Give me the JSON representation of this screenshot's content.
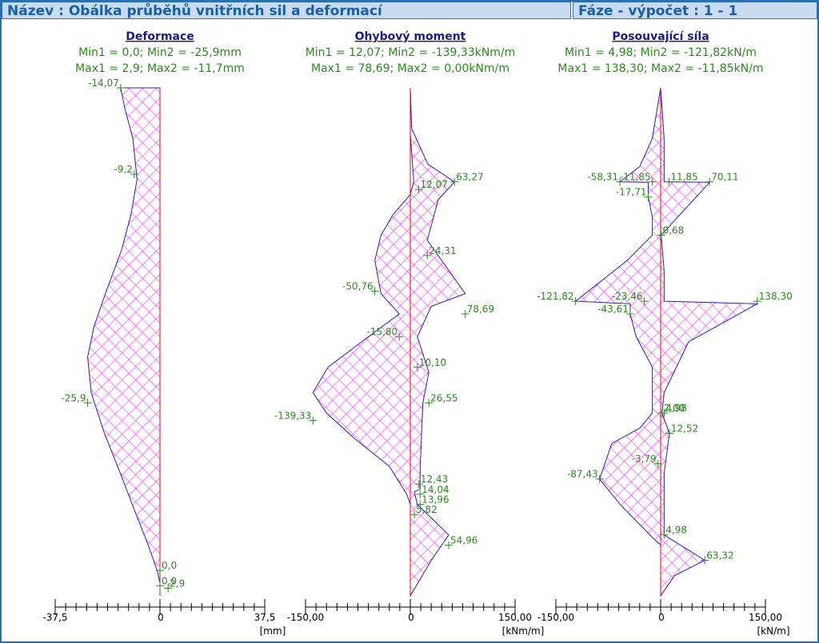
{
  "header": {
    "title": "Název : Obálka průběhů vnitřních sil a deformací",
    "phase": "Fáze - výpočet : 1 - 1"
  },
  "colors": {
    "fill": "#ff44ff",
    "outline": "#2020c0",
    "axis": "#ff0000",
    "label": "#2b8a1e",
    "title": "#1a1a8c",
    "header_bg": "#c9dcef",
    "header_text": "#1a5fa6"
  },
  "chart_data": [
    {
      "type": "area",
      "title": "Deformace",
      "stats": [
        "Min1 = 0,0; Min2 = -25,9mm",
        "Max1 = 2,9; Max2 = -11,7mm"
      ],
      "unit": "[mm]",
      "xlim": [
        -37.5,
        37.5
      ],
      "tick_labels": {
        "min": "-37,5",
        "zero": "0",
        "max": "37,5"
      },
      "depth_range": [
        0,
        1
      ],
      "envelope_min": {
        "depth": [
          0,
          0.04,
          0.1,
          0.18,
          0.25,
          0.32,
          0.4,
          0.47,
          0.53,
          0.6,
          0.68,
          0.76,
          0.84,
          0.9,
          0.95,
          0.975,
          1
        ],
        "value": [
          -14.07,
          -12.6,
          -9.7,
          -8.2,
          -10.4,
          -13.8,
          -19.2,
          -23.6,
          -25.9,
          -24.6,
          -19.9,
          -14.1,
          -8.5,
          -4.2,
          -1.0,
          0.0,
          0.0
        ]
      },
      "envelope_max": {
        "depth": [
          0,
          1
        ],
        "value": [
          0,
          0
        ]
      },
      "labels": [
        {
          "text": "-14,07",
          "value": -14.07,
          "depth": 0.0
        },
        {
          "text": "-9,2",
          "value": -9.2,
          "depth": 0.17
        },
        {
          "text": "-25,9",
          "value": -25.9,
          "depth": 0.62
        },
        {
          "text": "0,0",
          "value": 0.0,
          "depth": 0.95
        },
        {
          "text": "0,0",
          "value": 0.0,
          "depth": 0.98
        },
        {
          "text": "2,9",
          "value": 2.9,
          "depth": 0.985
        }
      ]
    },
    {
      "type": "area",
      "title": "Ohybový moment",
      "stats": [
        "Min1 = 12,07; Min2 = -139,33kNm/m",
        "Max1 = 78,69; Max2 = 0,00kNm/m"
      ],
      "unit": "[kNm/m]",
      "xlim": [
        -150,
        150
      ],
      "tick_labels": {
        "min": "-150,00",
        "zero": "0",
        "max": "150,00"
      },
      "depth_range": [
        0,
        1
      ],
      "envelope_min": {
        "depth": [
          0,
          0.09,
          0.185,
          0.21,
          0.25,
          0.29,
          0.34,
          0.405,
          0.445,
          0.49,
          0.55,
          0.6,
          0.64,
          0.69,
          0.745,
          0.8,
          0.82,
          1
        ],
        "value": [
          0,
          0,
          5,
          0,
          -25,
          -42,
          -50.76,
          -42,
          -15.8,
          -60,
          -118,
          -139.33,
          -120,
          -80,
          -30,
          -5,
          0,
          0
        ]
      },
      "envelope_max": {
        "depth": [
          0,
          0.08,
          0.15,
          0.185,
          0.22,
          0.3,
          0.405,
          0.43,
          0.49,
          0.56,
          0.62,
          0.75,
          0.79,
          0.795,
          0.82,
          0.88,
          0.93,
          1
        ],
        "value": [
          0,
          2,
          25,
          63.27,
          40,
          24.31,
          78.69,
          30,
          10.1,
          26.55,
          18,
          14.04,
          13.96,
          5.82,
          10,
          54.96,
          30,
          0
        ]
      },
      "labels": [
        {
          "text": "63,27",
          "value": 63.27,
          "depth": 0.185
        },
        {
          "text": "12,07",
          "value": 12.07,
          "depth": 0.2
        },
        {
          "text": "24,31",
          "value": 24.31,
          "depth": 0.33
        },
        {
          "text": "-50,76",
          "value": -50.76,
          "depth": 0.4
        },
        {
          "text": "78,69",
          "value": 78.69,
          "depth": 0.445
        },
        {
          "text": "-15,80",
          "value": -15.8,
          "depth": 0.49
        },
        {
          "text": "10,10",
          "value": 10.1,
          "depth": 0.55
        },
        {
          "text": "26,55",
          "value": 26.55,
          "depth": 0.62
        },
        {
          "text": "-139,33",
          "value": -139.33,
          "depth": 0.655
        },
        {
          "text": "12,43",
          "value": 12.43,
          "depth": 0.78
        },
        {
          "text": "14,04",
          "value": 14.04,
          "depth": 0.8
        },
        {
          "text": "13,96",
          "value": 13.96,
          "depth": 0.82
        },
        {
          "text": "5,82",
          "value": 5.82,
          "depth": 0.84
        },
        {
          "text": "54,96",
          "value": 54.96,
          "depth": 0.9
        }
      ]
    },
    {
      "type": "area",
      "title": "Posouvající síla",
      "stats": [
        "Min1 = 4,98; Min2 = -121,82kN/m",
        "Max1 = 138,30; Max2 = -11,85kN/m"
      ],
      "unit": "[kN/m]",
      "xlim": [
        -150,
        150
      ],
      "tick_labels": {
        "min": "-150,00",
        "zero": "0",
        "max": "150,00"
      },
      "depth_range": [
        0,
        1
      ],
      "envelope_min": {
        "depth": [
          0,
          0.1,
          0.155,
          0.185,
          0.186,
          0.215,
          0.255,
          0.29,
          0.34,
          0.42,
          0.425,
          0.445,
          0.49,
          0.55,
          0.64,
          0.67,
          0.7,
          0.77,
          0.82,
          0.885,
          0.9,
          1
        ],
        "value": [
          0,
          -12,
          -30,
          -58.31,
          -17.71,
          -17.71,
          -11.85,
          -11.85,
          -48,
          -121.82,
          -43.61,
          -43.61,
          -35,
          -11.85,
          -11.85,
          -30,
          -70,
          -87.43,
          -58,
          -11.85,
          0,
          0
        ]
      },
      "envelope_max": {
        "depth": [
          0,
          0.1,
          0.185,
          0.186,
          0.29,
          0.36,
          0.42,
          0.425,
          0.5,
          0.6,
          0.64,
          0.68,
          0.76,
          0.88,
          0.93,
          0.96,
          1
        ],
        "value": [
          0,
          4.98,
          4.98,
          70.11,
          0.68,
          4.98,
          4.98,
          138.3,
          40,
          4.98,
          2.0,
          12.52,
          4.98,
          4.98,
          63.32,
          20,
          0
        ]
      },
      "labels": [
        {
          "text": "-58,31",
          "value": -58.31,
          "depth": 0.185
        },
        {
          "text": "-11,85",
          "value": -11.85,
          "depth": 0.185
        },
        {
          "text": "11,85",
          "value": 11.85,
          "depth": 0.185
        },
        {
          "text": "70,11",
          "value": 70.11,
          "depth": 0.185
        },
        {
          "text": "-17,71",
          "value": -17.71,
          "depth": 0.215
        },
        {
          "text": "0,68",
          "value": 0.68,
          "depth": 0.29
        },
        {
          "text": "-121,82",
          "value": -121.82,
          "depth": 0.42
        },
        {
          "text": "-23,46",
          "value": -23.46,
          "depth": 0.42
        },
        {
          "text": "138,30",
          "value": 138.3,
          "depth": 0.42
        },
        {
          "text": "-43,61",
          "value": -43.61,
          "depth": 0.445
        },
        {
          "text": "4,98",
          "value": 4.98,
          "depth": 0.64
        },
        {
          "text": "2,00",
          "value": 2.0,
          "depth": 0.64
        },
        {
          "text": "12,52",
          "value": 12.52,
          "depth": 0.68
        },
        {
          "text": "-3,79",
          "value": -3.79,
          "depth": 0.74
        },
        {
          "text": "-87,43",
          "value": -87.43,
          "depth": 0.77
        },
        {
          "text": "4,98",
          "value": 4.98,
          "depth": 0.88
        },
        {
          "text": "63,32",
          "value": 63.32,
          "depth": 0.93
        }
      ]
    }
  ]
}
